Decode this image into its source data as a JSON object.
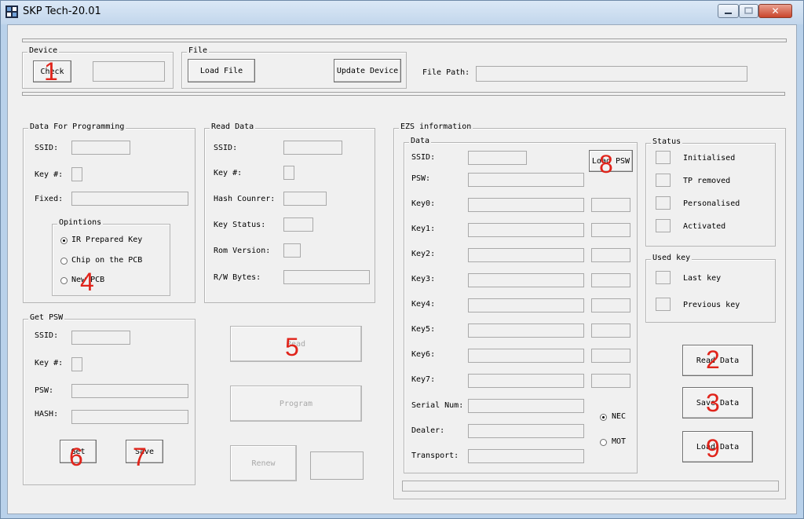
{
  "window": {
    "title": "SKP Tech-20.01"
  },
  "device": {
    "legend": "Device",
    "check_label": "Check"
  },
  "file": {
    "legend": "File",
    "load_file_label": "Load File",
    "update_device_label": "Update Device",
    "file_path_label": "File Path:"
  },
  "programming": {
    "legend": "Data For Programming",
    "ssid_label": "SSID:",
    "key_label": "Key #:",
    "fixed_label": "Fixed:",
    "options": {
      "legend": "Opintions",
      "items": [
        "IR Prepared Key",
        "Chip on the PCB",
        "New PCB"
      ],
      "selected": "IR Prepared Key"
    }
  },
  "read_data": {
    "legend": "Read Data",
    "ssid_label": "SSID:",
    "key_label": "Key #:",
    "hash_counter_label": "Hash Counrer:",
    "key_status_label": "Key Status:",
    "rom_version_label": "Rom Version:",
    "rw_bytes_label": "R/W Bytes:"
  },
  "get_psw": {
    "legend": "Get PSW",
    "ssid_label": "SSID:",
    "key_label": "Key #:",
    "psw_label": "PSW:",
    "hash_label": "HASH:",
    "get_label": "Get",
    "save_label": "Save"
  },
  "actions": {
    "read_label": "Read",
    "program_label": "Program",
    "renew_label": "Renew"
  },
  "ezs": {
    "legend": "EZS information",
    "data": {
      "legend": "Data",
      "ssid_label": "SSID:",
      "psw_label": "PSW:",
      "load_psw_label": "Load PSW",
      "keys": [
        "Key0:",
        "Key1:",
        "Key2:",
        "Key3:",
        "Key4:",
        "Key5:",
        "Key6:",
        "Key7:"
      ],
      "serial_label": "Serial Num:",
      "dealer_label": "Dealer:",
      "transport_label": "Transport:",
      "nec_label": "NEC",
      "mot_label": "MOT",
      "selected": "NEC"
    },
    "status": {
      "legend": "Status",
      "items": [
        "Initialised",
        "TP removed",
        "Personalised",
        "Activated"
      ]
    },
    "used_key": {
      "legend": "Used key",
      "items": [
        "Last key",
        "Previous key"
      ]
    },
    "read_data_label": "Read Data",
    "save_data_label": "Save Data",
    "load_data_label": "Load Data"
  },
  "markers": [
    "1",
    "2",
    "3",
    "4",
    "5",
    "6",
    "7",
    "8",
    "9"
  ]
}
